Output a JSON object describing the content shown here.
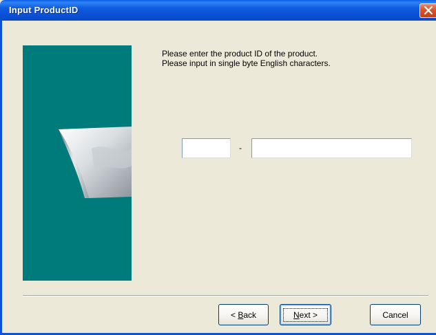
{
  "window": {
    "title": "Input ProductID",
    "close_icon": "close-x-icon"
  },
  "banner": {
    "color": "#007b7b",
    "image": "curled-page-graphic"
  },
  "instructions": {
    "line1": "Please enter the product ID of the product.",
    "line2": "Please input in single byte English characters."
  },
  "product_id": {
    "prefix_value": "",
    "separator": "-",
    "suffix_value": ""
  },
  "buttons": {
    "back_prefix": "< ",
    "back_key": "B",
    "back_rest": "ack",
    "next_key": "N",
    "next_rest": "ext >",
    "cancel": "Cancel"
  },
  "colors": {
    "titlebar": "#0b52d6",
    "dialog_bg": "#ece9d8",
    "close": "#d9542b"
  }
}
